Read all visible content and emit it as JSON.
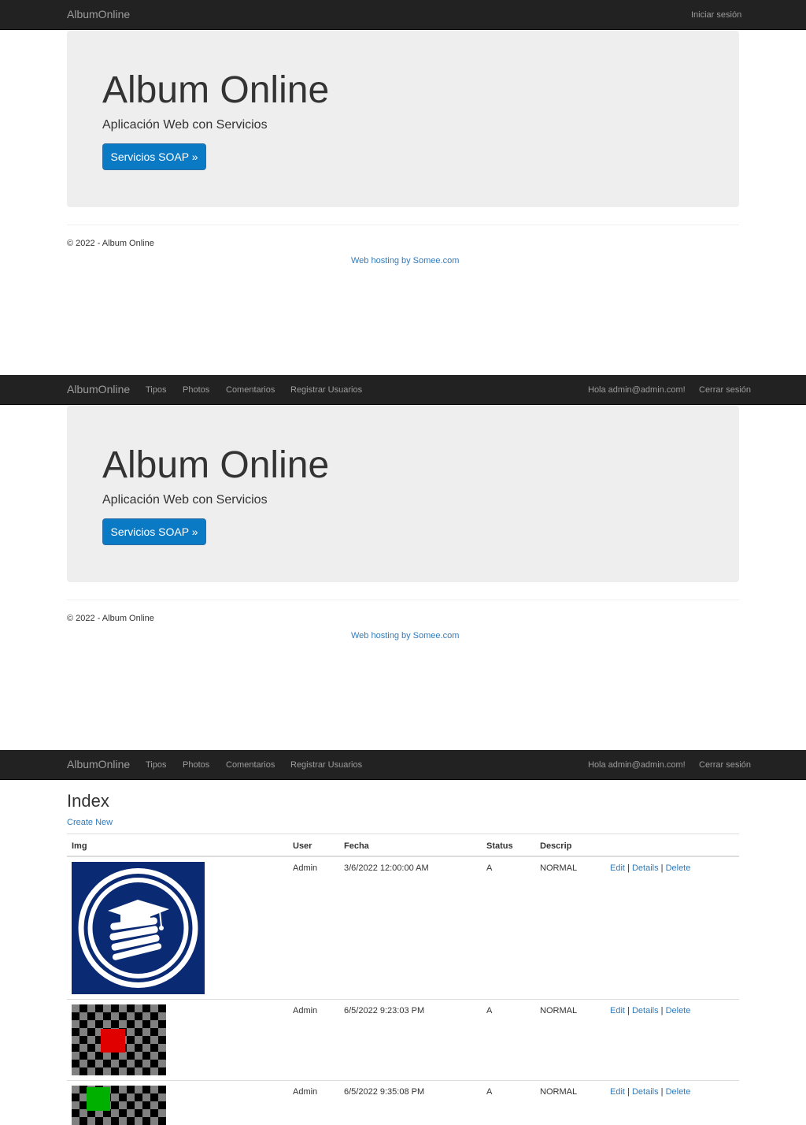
{
  "brand": "AlbumOnline",
  "nav_guest": {
    "login": "Iniciar sesión"
  },
  "nav_user": {
    "items": [
      "Tipos",
      "Photos",
      "Comentarios",
      "Registrar Usuarios"
    ],
    "greeting": "Hola admin@admin.com!",
    "logout": "Cerrar sesión"
  },
  "jumbotron": {
    "title": "Album Online",
    "lead": "Aplicación Web con Servicios",
    "button": "Servicios SOAP »"
  },
  "footer": {
    "copyright": "© 2022 - Album Online",
    "hosting": "Web hosting by Somee.com"
  },
  "index": {
    "title": "Index",
    "create_new": "Create New",
    "columns": [
      "Img",
      "User",
      "Fecha",
      "Status",
      "Descrip"
    ],
    "action_labels": {
      "edit": "Edit",
      "details": "Details",
      "delete": "Delete",
      "separator": "|"
    },
    "rows": [
      {
        "user": "Admin",
        "fecha": "3/6/2022 12:00:00 AM",
        "status": "A",
        "descrip": "NORMAL",
        "image": "graduation-cap-books-logo"
      },
      {
        "user": "Admin",
        "fecha": "6/5/2022 9:23:03 PM",
        "status": "A",
        "descrip": "NORMAL",
        "image": "checkerboard-red-square"
      },
      {
        "user": "Admin",
        "fecha": "6/5/2022 9:35:08 PM",
        "status": "A",
        "descrip": "NORMAL",
        "image": "checkerboard-green-square"
      }
    ]
  },
  "colors": {
    "navbar": "#222222",
    "nav_text": "#9d9d9d",
    "jumbotron": "#eeeeee",
    "primary": "#0b7ac5",
    "link": "#337ab7",
    "logo_blue": "#0a2a73",
    "red": "#e00000",
    "green": "#00b000"
  }
}
